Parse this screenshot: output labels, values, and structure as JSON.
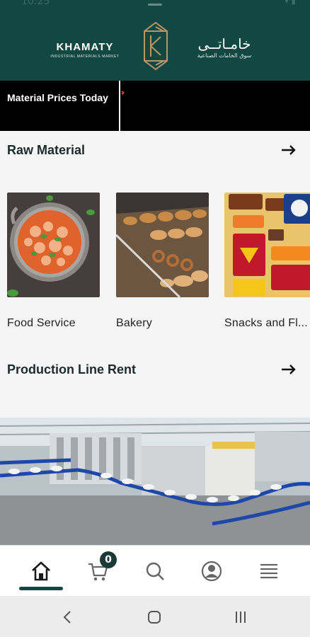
{
  "status_bar": {
    "time": "10:25"
  },
  "header": {
    "brand_en": "KHAMATY",
    "tagline_en": "INDUSTRIAL MATERIALS MARKET",
    "brand_ar": "خامـاتــى",
    "tagline_ar": "سوق الخامات الصناعية",
    "background": "#124742"
  },
  "ticker": {
    "label": "Material Prices Today"
  },
  "raw_material": {
    "title": "Raw Material",
    "arrow_icon": "arrow-right-icon",
    "categories": [
      {
        "label": "Food Service"
      },
      {
        "label": "Bakery"
      },
      {
        "label": "Snacks and Fl..."
      }
    ]
  },
  "production": {
    "title": "Production Line Rent",
    "arrow_icon": "arrow-right-icon"
  },
  "bottom_nav": {
    "items": [
      {
        "icon": "home-icon",
        "active": true
      },
      {
        "icon": "cart-icon",
        "badge": "0"
      },
      {
        "icon": "search-icon"
      },
      {
        "icon": "profile-icon"
      },
      {
        "icon": "menu-icon"
      }
    ],
    "accent": "#124742"
  },
  "system_nav": {
    "items": [
      "back-icon",
      "home-circle-icon",
      "recents-icon"
    ]
  }
}
